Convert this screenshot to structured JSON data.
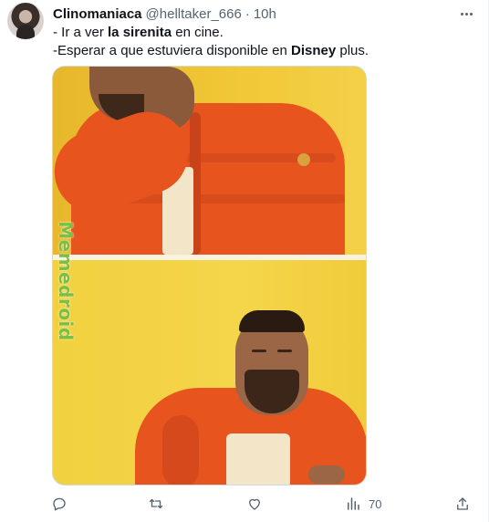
{
  "tweet": {
    "display_name": "Clinomaniaca",
    "handle": "@helltaker_666",
    "separator": "·",
    "time": "10h",
    "text": {
      "line1_prefix": "- Ir a ver ",
      "line1_bold": "la sirenita",
      "line1_suffix": " en cine.",
      "line2_prefix": "-Esperar a que estuviera disponible en ",
      "line2_bold": "Disney",
      "line2_suffix": " plus."
    },
    "media": {
      "type": "meme image (two-panel)",
      "watermark": "Memedroid"
    },
    "actions": {
      "reply_icon": "reply-icon",
      "retweet_icon": "retweet-icon",
      "like_icon": "heart-icon",
      "views_icon": "views-icon",
      "views_count": "70",
      "share_icon": "share-icon"
    }
  },
  "colors": {
    "text_primary": "#0f1419",
    "text_secondary": "#536471",
    "border": "#cfd9de",
    "watermark_green": "#7bc043"
  }
}
